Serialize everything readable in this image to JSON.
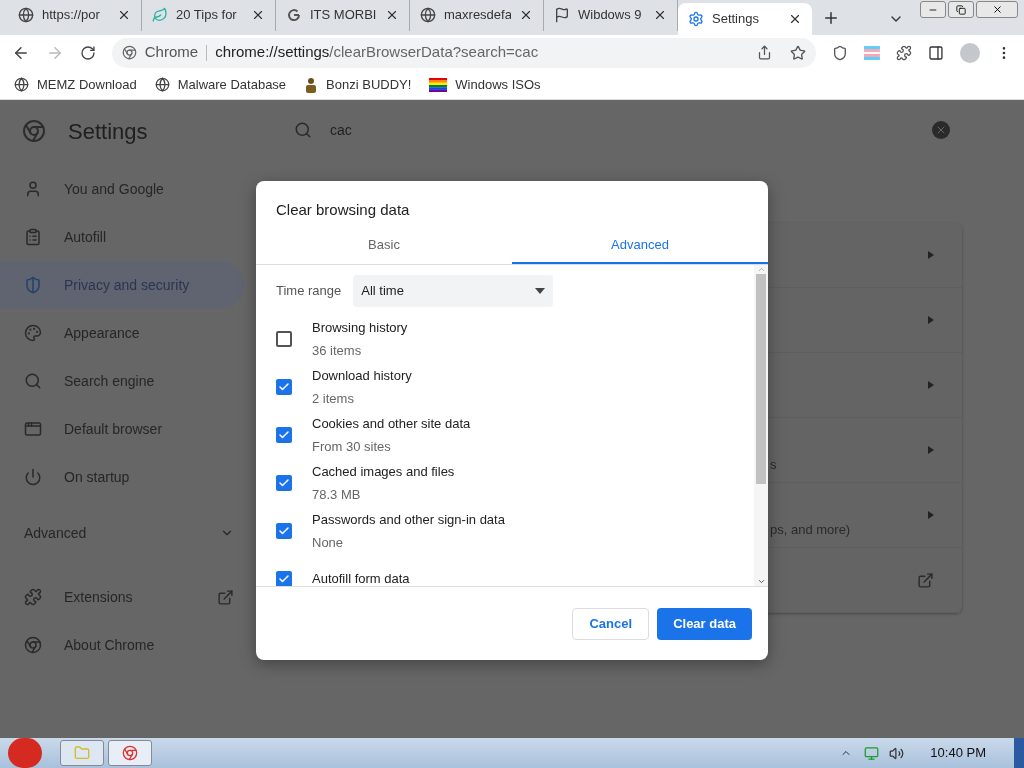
{
  "browser_tabs": [
    {
      "title": "https://por",
      "selected": false
    },
    {
      "title": "20 Tips for",
      "selected": false
    },
    {
      "title": "ITS MORBI",
      "selected": false
    },
    {
      "title": "maxresdefa",
      "selected": false
    },
    {
      "title": "Wibdows 9",
      "selected": false
    },
    {
      "title": "Settings",
      "selected": true
    }
  ],
  "address_bar": {
    "site_label": "Chrome",
    "url_host": "chrome://settings",
    "url_path": "/clearBrowserData?search=cac"
  },
  "bookmarks": [
    {
      "label": "MEMZ Download"
    },
    {
      "label": "Malware Database"
    },
    {
      "label": "Bonzi BUDDY!"
    },
    {
      "label": "Windows ISOs"
    }
  ],
  "settings": {
    "title": "Settings",
    "search": {
      "value": "cac"
    },
    "sidebar": [
      {
        "label": "You and Google",
        "selected": false
      },
      {
        "label": "Autofill",
        "selected": false
      },
      {
        "label": "Privacy and security",
        "selected": true
      },
      {
        "label": "Appearance",
        "selected": false
      },
      {
        "label": "Search engine",
        "selected": false
      },
      {
        "label": "Default browser",
        "selected": false
      },
      {
        "label": "On startup",
        "selected": false
      }
    ],
    "advanced": {
      "label": "Advanced",
      "expanded": false
    },
    "sidebar_bottom": [
      {
        "label": "Extensions"
      },
      {
        "label": "About Chrome"
      }
    ],
    "card_rows": [
      {
        "kind": "arrow"
      },
      {
        "kind": "arrow"
      },
      {
        "kind": "arrow"
      },
      {
        "text": "s",
        "kind": "arrow"
      },
      {
        "text": "ps, and more)",
        "kind": "arrow"
      },
      {
        "kind": "external"
      }
    ]
  },
  "dialog": {
    "title": "Clear browsing data",
    "tabs": [
      {
        "label": "Basic",
        "selected": false
      },
      {
        "label": "Advanced",
        "selected": true
      }
    ],
    "time_range": {
      "label": "Time range",
      "value": "All time"
    },
    "items": [
      {
        "label": "Browsing history",
        "detail": "36 items",
        "checked": false
      },
      {
        "label": "Download history",
        "detail": "2 items",
        "checked": true
      },
      {
        "label": "Cookies and other site data",
        "detail": "From 30 sites",
        "checked": true
      },
      {
        "label": "Cached images and files",
        "detail": "78.3 MB",
        "checked": true
      },
      {
        "label": "Passwords and other sign-in data",
        "detail": "None",
        "checked": true
      },
      {
        "label": "Autofill form data",
        "checked": true
      }
    ],
    "buttons": [
      {
        "label": "Cancel",
        "kind": "secondary"
      },
      {
        "label": "Clear data",
        "kind": "primary"
      }
    ]
  },
  "taskbar": {
    "clock": "10:40 PM"
  }
}
